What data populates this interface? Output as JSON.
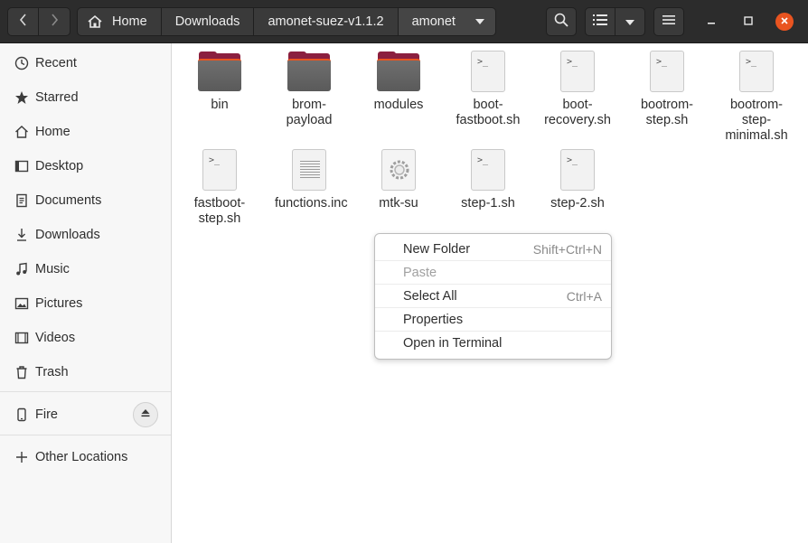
{
  "header": {
    "breadcrumbs": [
      "Home",
      "Downloads",
      "amonet-suez-v1.1.2",
      "amonet"
    ],
    "icons": [
      "back-icon",
      "forward-icon",
      "home-icon",
      "dropdown-icon",
      "search-icon",
      "list-view-icon",
      "view-options-icon",
      "menu-icon",
      "minimize-icon",
      "maximize-icon",
      "close-icon"
    ]
  },
  "sidebar": {
    "places": [
      {
        "label": "Recent",
        "icon": "clock-icon"
      },
      {
        "label": "Starred",
        "icon": "star-icon"
      },
      {
        "label": "Home",
        "icon": "home-icon"
      },
      {
        "label": "Desktop",
        "icon": "desktop-icon"
      },
      {
        "label": "Documents",
        "icon": "document-icon"
      },
      {
        "label": "Downloads",
        "icon": "download-icon"
      },
      {
        "label": "Music",
        "icon": "music-icon"
      },
      {
        "label": "Pictures",
        "icon": "pictures-icon"
      },
      {
        "label": "Videos",
        "icon": "video-icon"
      },
      {
        "label": "Trash",
        "icon": "trash-icon"
      }
    ],
    "device": {
      "label": "Fire",
      "icon": "phone-icon"
    },
    "other": {
      "label": "Other Locations",
      "icon": "plus-icon"
    }
  },
  "files": [
    {
      "name": "bin",
      "type": "folder"
    },
    {
      "name": "brom-payload",
      "type": "folder"
    },
    {
      "name": "modules",
      "type": "folder"
    },
    {
      "name": "boot-fastboot.sh",
      "type": "script"
    },
    {
      "name": "boot-recovery.sh",
      "type": "script"
    },
    {
      "name": "bootrom-step.sh",
      "type": "script"
    },
    {
      "name": "bootrom-step-minimal.sh",
      "type": "script"
    },
    {
      "name": "fastboot-step.sh",
      "type": "script"
    },
    {
      "name": "functions.inc",
      "type": "text"
    },
    {
      "name": "mtk-su",
      "type": "executable"
    },
    {
      "name": "step-1.sh",
      "type": "script"
    },
    {
      "name": "step-2.sh",
      "type": "script"
    }
  ],
  "context_menu": {
    "items": [
      {
        "label": "New Folder",
        "shortcut": "Shift+Ctrl+N",
        "enabled": true
      },
      {
        "label": "Paste",
        "shortcut": "",
        "enabled": false
      },
      {
        "label": "Select All",
        "shortcut": "Ctrl+A",
        "enabled": true
      },
      {
        "label": "Properties",
        "shortcut": "",
        "enabled": true
      },
      {
        "label": "Open in Terminal",
        "shortcut": "",
        "enabled": true
      }
    ]
  },
  "colors": {
    "accent": "#e95420",
    "header_bg": "#2c2c2c",
    "folder_tab": "#8b1f3f"
  }
}
